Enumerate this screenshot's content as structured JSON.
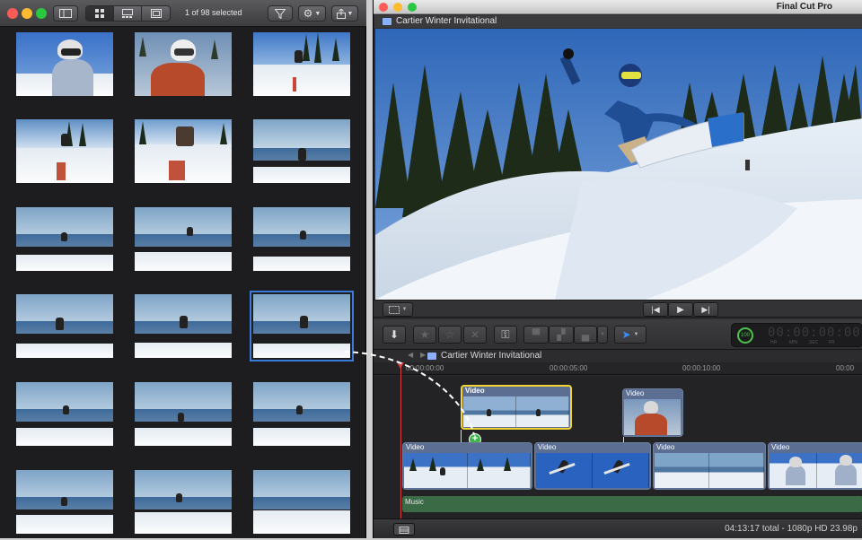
{
  "photos_window": {
    "selection_count": "1 of 98 selected",
    "view_modes": [
      "grid-view",
      "filmstrip-view",
      "single-view"
    ],
    "thumbnails": [
      "snowboarder-portrait",
      "snowboarder-red-jacket",
      "rider-on-slope",
      "rider-on-rail",
      "rider-red-rail",
      "rider-jump-lake",
      "rider-air-lake",
      "rider-air-lake",
      "rider-air-lake",
      "rider-air-lake",
      "rider-air-lake",
      "rider-air-lake-selected",
      "rider-landing",
      "rider-landing",
      "rider-landing",
      "rider-landing",
      "rider-landing",
      "rider-landing"
    ]
  },
  "fcp_window": {
    "app_title": "Final Cut Pro",
    "viewer_title": "Cartier Winter Invitational",
    "timeline_title": "Cartier Winter Invitational",
    "timecode_readout": "00:00:00:00",
    "timecode_units": [
      "HR",
      "MIN",
      "SEC",
      "FR"
    ],
    "zoom_level": "100",
    "ruler_labels": [
      "00:00:00:00",
      "00:00:05:00",
      "00:00:10:00"
    ],
    "connected_clip_labels": [
      "Video",
      "Video"
    ],
    "primary_clip_labels": [
      "Video",
      "Video",
      "Video",
      "Video"
    ],
    "music_label": "Music",
    "status_info": "04:13:17 total - 1080p HD 23.98p"
  },
  "colors": {
    "accent_selection": "#3b7bdb",
    "clip_highlight": "#f2d335",
    "playhead": "#d94141",
    "add_badge": "#3fb64a",
    "music_lane": "#3b6b46"
  }
}
